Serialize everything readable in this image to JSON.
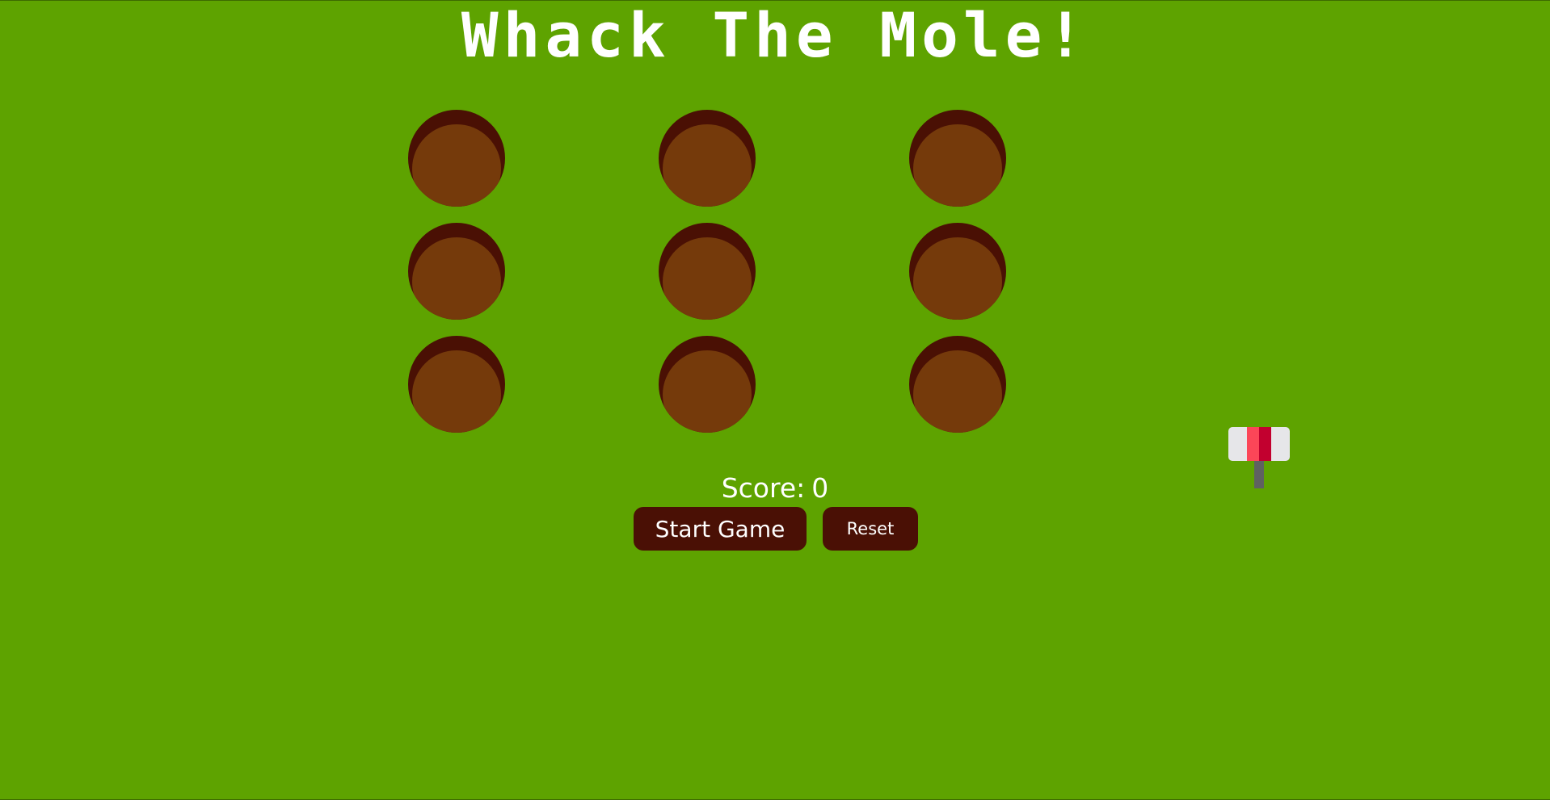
{
  "game": {
    "title": "Whack The Mole!",
    "score_label": "Score:",
    "score_value": "0",
    "holes": 9
  },
  "controls": {
    "start_label": "Start Game",
    "reset_label": "Reset"
  },
  "cursor": {
    "icon": "hammer-icon"
  },
  "colors": {
    "background": "#5ea300",
    "hole_rim": "#4a1004",
    "hole_dirt": "#753a0b",
    "button_bg": "#4a1005",
    "text": "#ffffff",
    "hammer_head": "#e6e6e9",
    "hammer_stripe_light": "#fc4658",
    "hammer_stripe_dark": "#c2002f",
    "hammer_handle": "#5f6161"
  }
}
